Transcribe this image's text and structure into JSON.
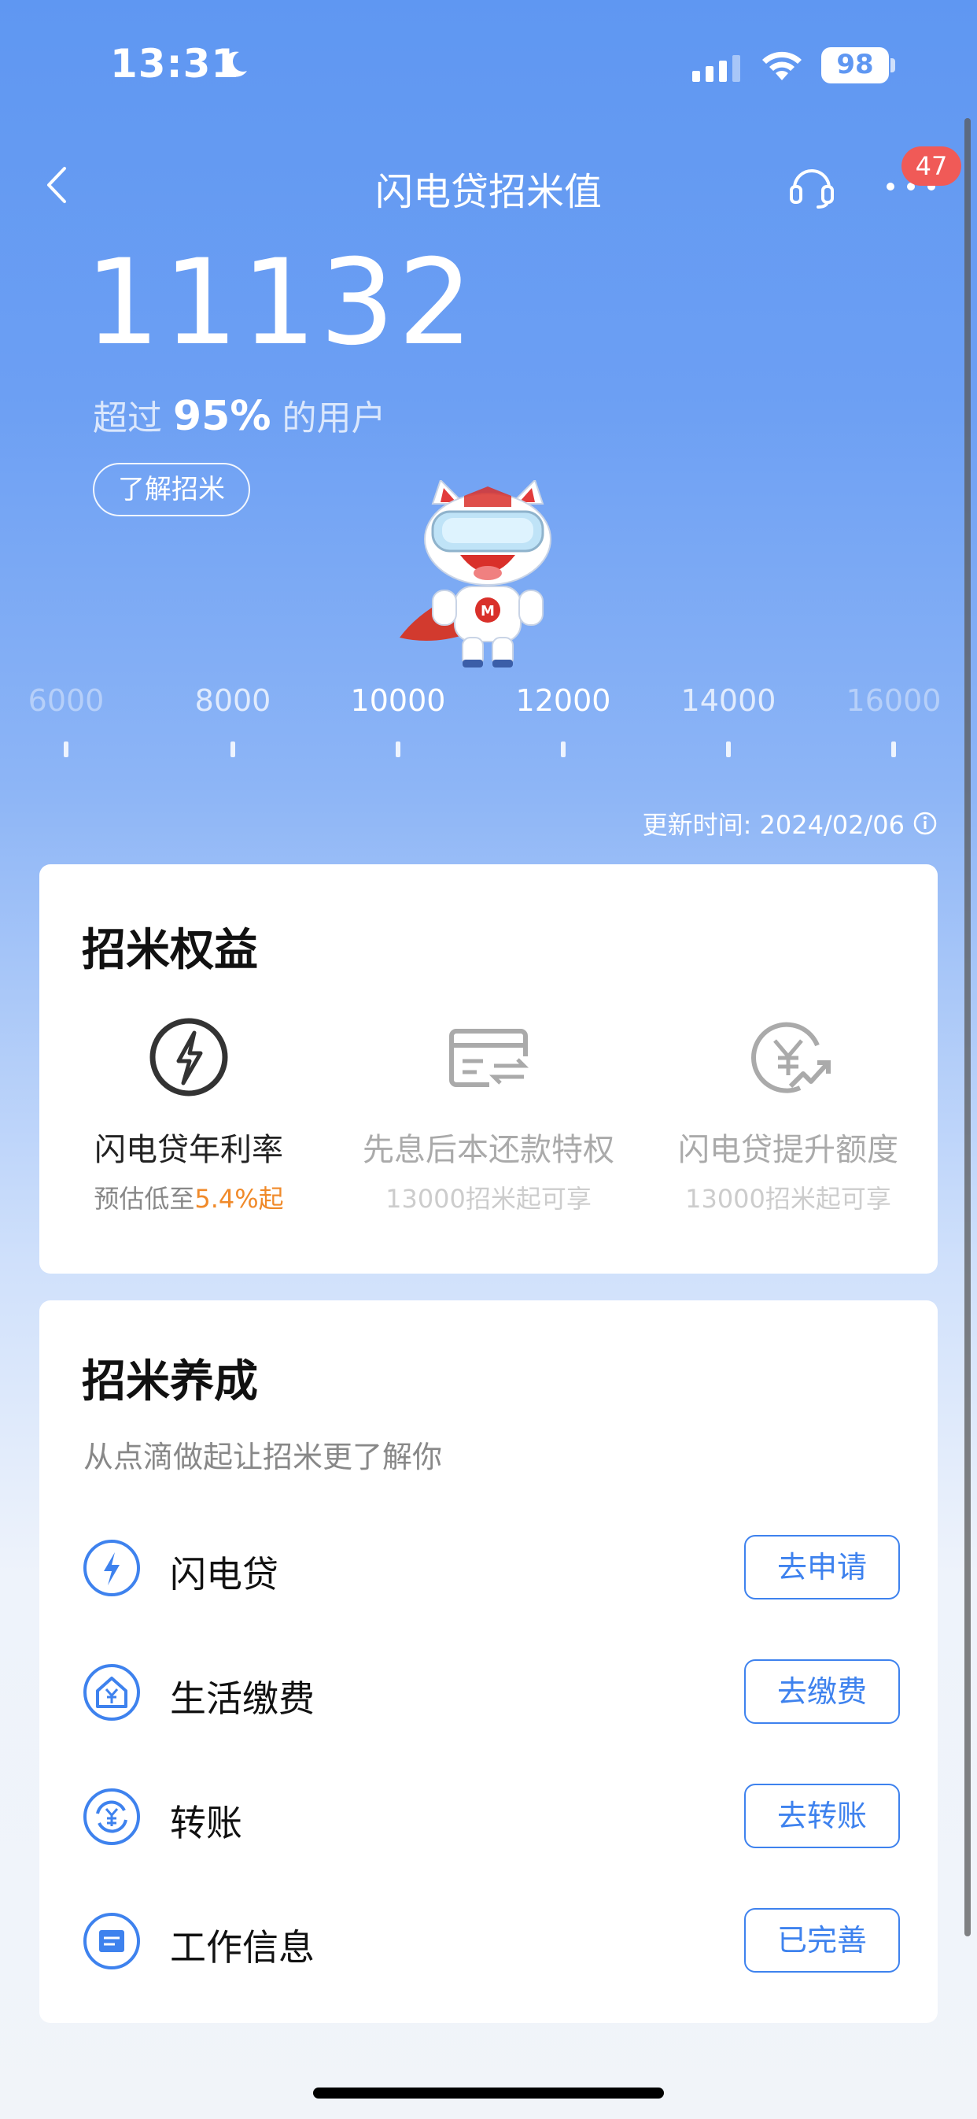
{
  "status_bar": {
    "time": "13:31",
    "battery": "98"
  },
  "nav": {
    "title": "闪电贷招米值",
    "badge": "47"
  },
  "hero": {
    "score": "11132",
    "exceed_prefix": "超过",
    "exceed_value": "95%",
    "exceed_suffix": "的用户",
    "learn_button": "了解招米"
  },
  "scale": {
    "ticks": [
      "6000",
      "8000",
      "10000",
      "12000",
      "14000",
      "16000"
    ]
  },
  "update_time": "更新时间: 2024/02/06",
  "benefits": {
    "title": "招米权益",
    "items": [
      {
        "name": "闪电贷年利率",
        "sub_prefix": "预估低至",
        "sub_highlight": "5.4%起",
        "icon": "lightning-icon"
      },
      {
        "name": "先息后本还款特权",
        "sub": "13000招米起可享",
        "icon": "card-exchange-icon"
      },
      {
        "name": "闪电贷提升额度",
        "sub": "13000招米起可享",
        "icon": "yen-growth-icon"
      }
    ]
  },
  "grow": {
    "title": "招米养成",
    "subtitle": "从点滴做起让招米更了解你",
    "items": [
      {
        "label": "闪电贷",
        "button": "去申请",
        "icon": "lightning-icon"
      },
      {
        "label": "生活缴费",
        "button": "去缴费",
        "icon": "house-yen-icon"
      },
      {
        "label": "转账",
        "button": "去转账",
        "icon": "transfer-yen-icon"
      },
      {
        "label": "工作信息",
        "button": "已完善",
        "icon": "document-icon"
      }
    ]
  },
  "colors": {
    "accent": "#3e82ee",
    "highlight": "#f08a2a",
    "badge": "#f05a57"
  }
}
